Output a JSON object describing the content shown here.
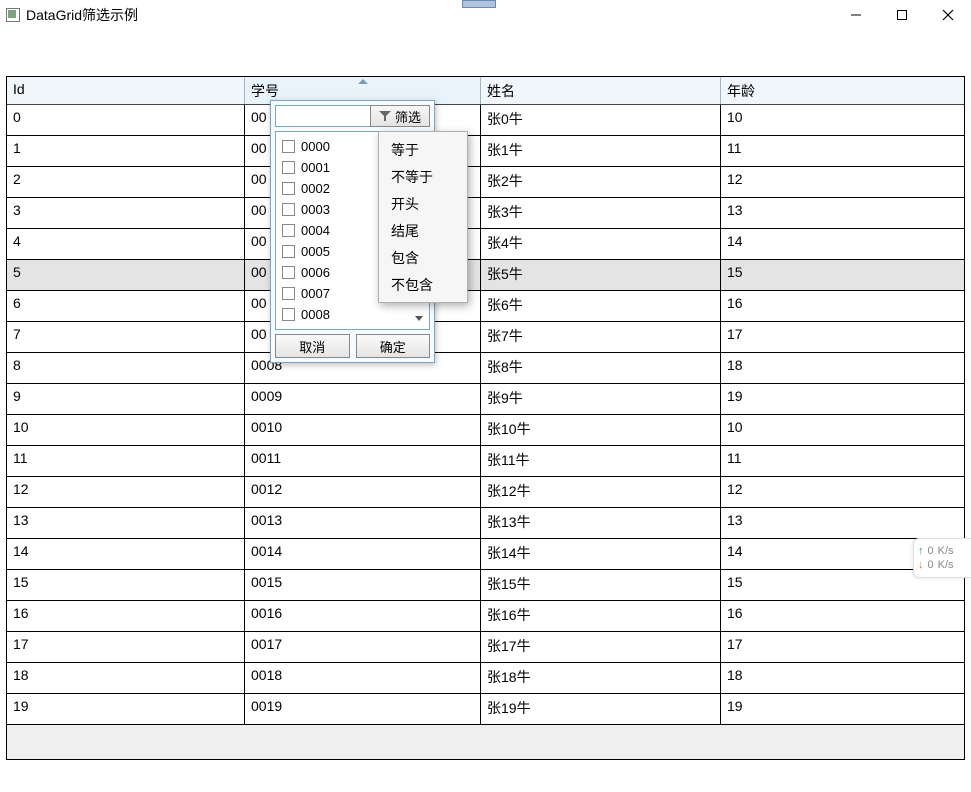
{
  "window": {
    "title": "DataGrid筛选示例"
  },
  "columns": [
    "Id",
    "学号",
    "姓名",
    "年龄"
  ],
  "rows": [
    {
      "id": "0",
      "code": "0000",
      "name": "张0牛",
      "age": "10"
    },
    {
      "id": "1",
      "code": "0001",
      "name": "张1牛",
      "age": "11"
    },
    {
      "id": "2",
      "code": "0002",
      "name": "张2牛",
      "age": "12"
    },
    {
      "id": "3",
      "code": "0003",
      "name": "张3牛",
      "age": "13"
    },
    {
      "id": "4",
      "code": "0004",
      "name": "张4牛",
      "age": "14"
    },
    {
      "id": "5",
      "code": "0005",
      "name": "张5牛",
      "age": "15"
    },
    {
      "id": "6",
      "code": "0006",
      "name": "张6牛",
      "age": "16"
    },
    {
      "id": "7",
      "code": "0007",
      "name": "张7牛",
      "age": "17"
    },
    {
      "id": "8",
      "code": "0008",
      "name": "张8牛",
      "age": "18"
    },
    {
      "id": "9",
      "code": "0009",
      "name": "张9牛",
      "age": "19"
    },
    {
      "id": "10",
      "code": "0010",
      "name": "张10牛",
      "age": "10"
    },
    {
      "id": "11",
      "code": "0011",
      "name": "张11牛",
      "age": "11"
    },
    {
      "id": "12",
      "code": "0012",
      "name": "张12牛",
      "age": "12"
    },
    {
      "id": "13",
      "code": "0013",
      "name": "张13牛",
      "age": "13"
    },
    {
      "id": "14",
      "code": "0014",
      "name": "张14牛",
      "age": "14"
    },
    {
      "id": "15",
      "code": "0015",
      "name": "张15牛",
      "age": "15"
    },
    {
      "id": "16",
      "code": "0016",
      "name": "张16牛",
      "age": "16"
    },
    {
      "id": "17",
      "code": "0017",
      "name": "张17牛",
      "age": "17"
    },
    {
      "id": "18",
      "code": "0018",
      "name": "张18牛",
      "age": "18"
    },
    {
      "id": "19",
      "code": "0019",
      "name": "张19牛",
      "age": "19"
    }
  ],
  "selected_row_index": 5,
  "filter_popup": {
    "search_value": "",
    "filter_button": "筛选",
    "options": [
      "0000",
      "0001",
      "0002",
      "0003",
      "0004",
      "0005",
      "0006",
      "0007",
      "0008"
    ],
    "cancel": "取消",
    "ok": "确定"
  },
  "operator_menu": [
    "等于",
    "不等于",
    "开头",
    "结尾",
    "包含",
    "不包含"
  ],
  "net_overlay": {
    "up": "0",
    "down": "0",
    "unit": "K/s"
  }
}
